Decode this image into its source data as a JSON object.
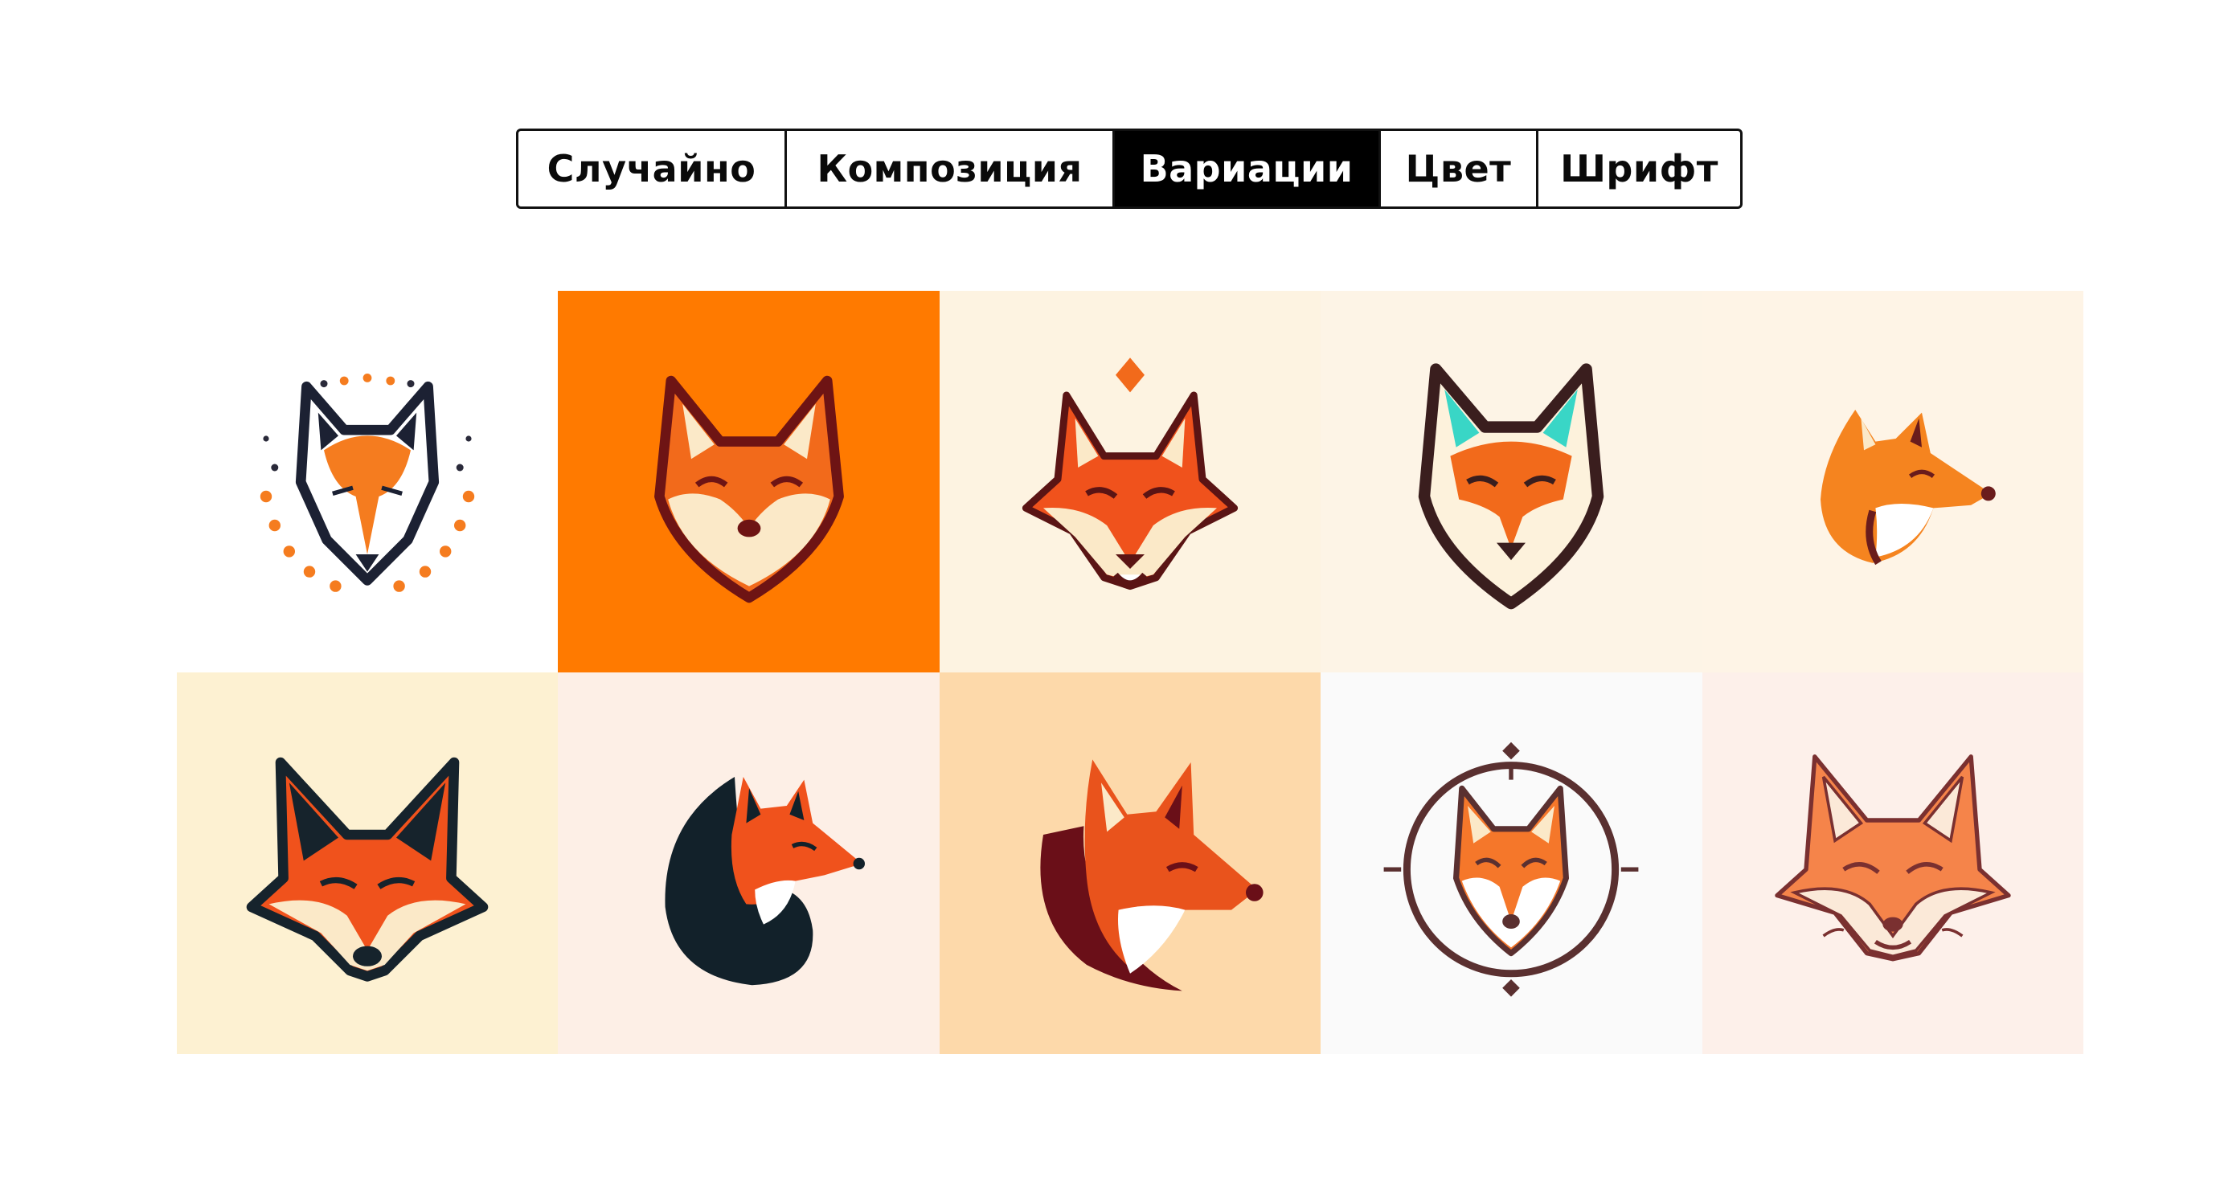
{
  "tabs": [
    {
      "label": "Случайно",
      "active": false
    },
    {
      "label": "Композиция",
      "active": false
    },
    {
      "label": "Вариации",
      "active": true
    },
    {
      "label": "Цвет",
      "active": false
    },
    {
      "label": "Шрифт",
      "active": false
    }
  ],
  "tiles": [
    {
      "icon": "fox-wolf-dotted-ring-icon",
      "bg": "#ffffff"
    },
    {
      "icon": "fox-smiling-head-icon",
      "bg": "#ff7a00"
    },
    {
      "icon": "fox-diamond-crest-icon",
      "bg": "#fdf3e1"
    },
    {
      "icon": "fox-teal-ears-icon",
      "bg": "#fdf4e6"
    },
    {
      "icon": "fox-profile-small-icon",
      "bg": "#fef4e6"
    },
    {
      "icon": "fox-dark-ears-icon",
      "bg": "#fdf1d2"
    },
    {
      "icon": "fox-curled-tail-icon",
      "bg": "#fdefe6"
    },
    {
      "icon": "fox-profile-large-icon",
      "bg": "#fdd9aa"
    },
    {
      "icon": "fox-circle-emblem-icon",
      "bg": "#fafafa"
    },
    {
      "icon": "fox-outline-smiling-icon",
      "bg": "#fdf0ea"
    }
  ],
  "colors": {
    "accent": "#ff7a00",
    "active_tab_bg": "#000000",
    "border": "#111111"
  }
}
